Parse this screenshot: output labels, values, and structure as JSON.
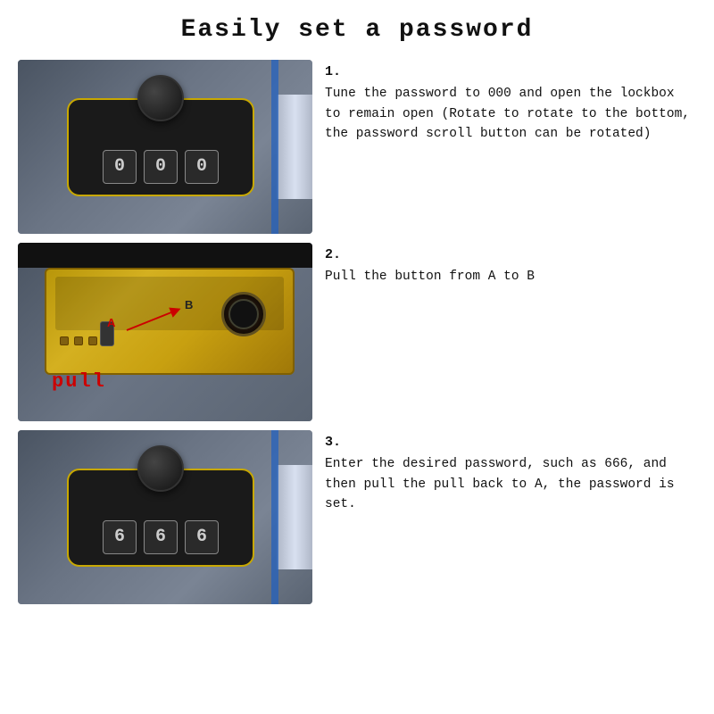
{
  "page": {
    "title": "Easily set a password",
    "background": "#ffffff"
  },
  "steps": [
    {
      "number": "1.",
      "text": "Tune the password to 000 and open the lockbox to remain open (Rotate to rotate to the bottom, the password scroll button can be rotated)",
      "image_alt": "Lockbox with dial and digit display showing 000"
    },
    {
      "number": "2.",
      "text": "Pull the button from A to B",
      "image_alt": "Internal mechanism of lockbox showing button A and position B with pull label"
    },
    {
      "number": "3.",
      "text": "Enter the desired password, such as 666, and then pull the pull back to A,  the password is set.",
      "image_alt": "Lockbox with dial and digit display showing 666"
    }
  ]
}
